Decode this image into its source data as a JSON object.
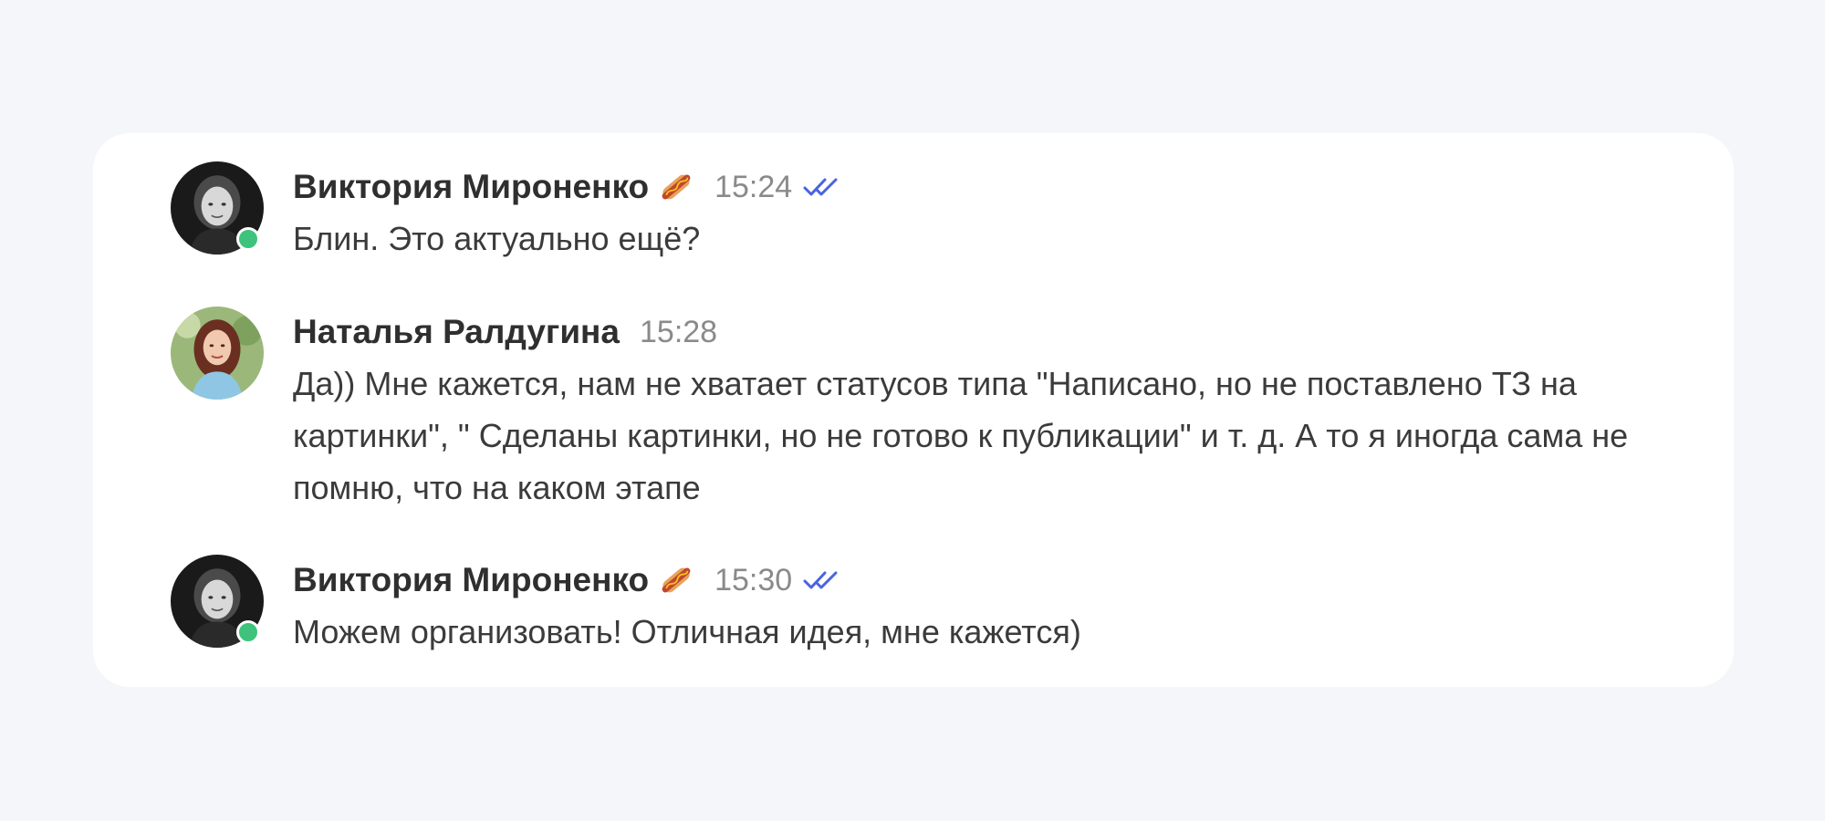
{
  "messages": [
    {
      "author": "Виктория Мироненко",
      "emoji": "hot-dog-emoji",
      "time": "15:24",
      "status": "read-double-check-icon",
      "online": true,
      "text": "Блин. Это актуально ещё?"
    },
    {
      "author": "Наталья Ралдугина",
      "time": "15:28",
      "online": false,
      "text": "Да)) Мне кажется, нам не хватает статусов типа \"Написано, но не поставлено ТЗ на картинки\", \" Сделаны картинки, но не готово к публикации\" и т. д. А то я иногда сама не помню, что на каком этапе"
    },
    {
      "author": "Виктория Мироненко",
      "emoji": "hot-dog-emoji",
      "time": "15:30",
      "status": "read-double-check-icon",
      "online": true,
      "text": "Можем организовать! Отличная идея, мне кажется)"
    }
  ],
  "colors": {
    "background": "#f5f6fa",
    "card": "#ffffff",
    "online": "#3fc37c",
    "read_check": "#4a63e0",
    "time": "#8a8a8a"
  }
}
